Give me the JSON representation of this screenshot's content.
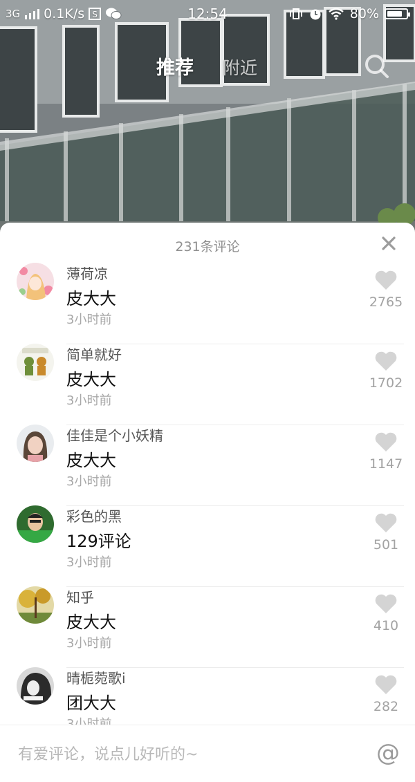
{
  "status_bar": {
    "network": "3G",
    "speed": "0.1K/s",
    "time": "12:54",
    "battery": "80%",
    "battery_level": 0.8
  },
  "nav": {
    "tabs": [
      {
        "label": "推荐",
        "active": true
      },
      {
        "label": "附近",
        "active": false
      }
    ]
  },
  "comments_panel": {
    "title": "231条评论",
    "comments": [
      {
        "author": "薄荷凉",
        "text": "皮大大",
        "time": "3小时前",
        "likes": "2765",
        "avatar_icon": "anime-girl-avatar"
      },
      {
        "author": "简单就好",
        "text": "皮大大",
        "time": "3小时前",
        "likes": "1702",
        "avatar_icon": "cartoon-bears-avatar"
      },
      {
        "author": "佳佳是个小妖精",
        "text": "皮大大",
        "time": "3小时前",
        "likes": "1147",
        "avatar_icon": "girl-photo-avatar"
      },
      {
        "author": "彩色的黑",
        "text": "129评论",
        "time": "3小时前",
        "likes": "501",
        "avatar_icon": "man-green-avatar"
      },
      {
        "author": "知乎",
        "text": "皮大大",
        "time": "3小时前",
        "likes": "410",
        "avatar_icon": "autumn-tree-avatar"
      },
      {
        "author": "晴栀菀歌i",
        "text": "团大大",
        "time": "3小时前",
        "likes": "282",
        "avatar_icon": "bw-girl-avatar"
      }
    ]
  },
  "input_bar": {
    "placeholder": "有爱评论，说点儿好听的~",
    "at_symbol": "@"
  },
  "colors": {
    "sheet_bg": "#ffffff",
    "muted_text": "#a8a8a8",
    "like_icon": "#d4d4d4"
  }
}
